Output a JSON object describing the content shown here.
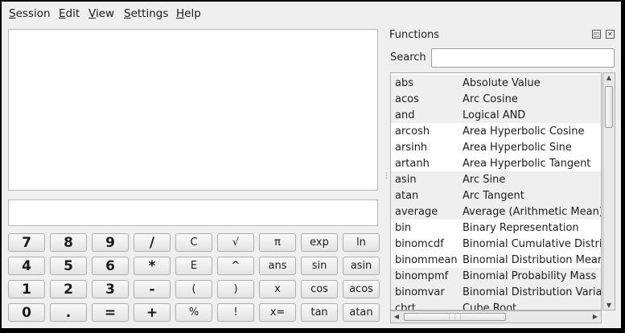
{
  "menu": [
    {
      "label": "Session",
      "accel": "S",
      "rest": "ession"
    },
    {
      "label": "Edit",
      "accel": "E",
      "rest": "dit"
    },
    {
      "label": "View",
      "accel": "V",
      "rest": "iew"
    },
    {
      "label": "Settings",
      "accel": "S",
      "rest": "ettings"
    },
    {
      "label": "Help",
      "accel": "H",
      "rest": "elp"
    }
  ],
  "result_display": "",
  "expression_input": "",
  "keypad": [
    [
      "7",
      "8",
      "9",
      "/",
      "C",
      "√",
      "π",
      "exp",
      "ln"
    ],
    [
      "4",
      "5",
      "6",
      "*",
      "E",
      "^",
      "ans",
      "sin",
      "asin"
    ],
    [
      "1",
      "2",
      "3",
      "-",
      "(",
      ")",
      "x",
      "cos",
      "acos"
    ],
    [
      "0",
      ".",
      "=",
      "+",
      "%",
      "!",
      "x=",
      "tan",
      "atan"
    ]
  ],
  "functions_panel": {
    "title": "Functions",
    "search_label": "Search",
    "search_value": "",
    "items": [
      {
        "name": "abs",
        "description": "Absolute Value"
      },
      {
        "name": "acos",
        "description": "Arc Cosine"
      },
      {
        "name": "and",
        "description": "Logical AND"
      },
      {
        "name": "arcosh",
        "description": "Area Hyperbolic Cosine"
      },
      {
        "name": "arsinh",
        "description": "Area Hyperbolic Sine"
      },
      {
        "name": "artanh",
        "description": "Area Hyperbolic Tangent"
      },
      {
        "name": "asin",
        "description": "Arc Sine"
      },
      {
        "name": "atan",
        "description": "Arc Tangent"
      },
      {
        "name": "average",
        "description": "Average (Arithmetic Mean)"
      },
      {
        "name": "bin",
        "description": "Binary Representation"
      },
      {
        "name": "binomcdf",
        "description": "Binomial Cumulative Distribution"
      },
      {
        "name": "binommean",
        "description": "Binomial Distribution Mean"
      },
      {
        "name": "binompmf",
        "description": "Binomial Probability Mass"
      },
      {
        "name": "binomvar",
        "description": "Binomial Distribution Variance"
      },
      {
        "name": "cbrt",
        "description": "Cube Root"
      }
    ]
  }
}
